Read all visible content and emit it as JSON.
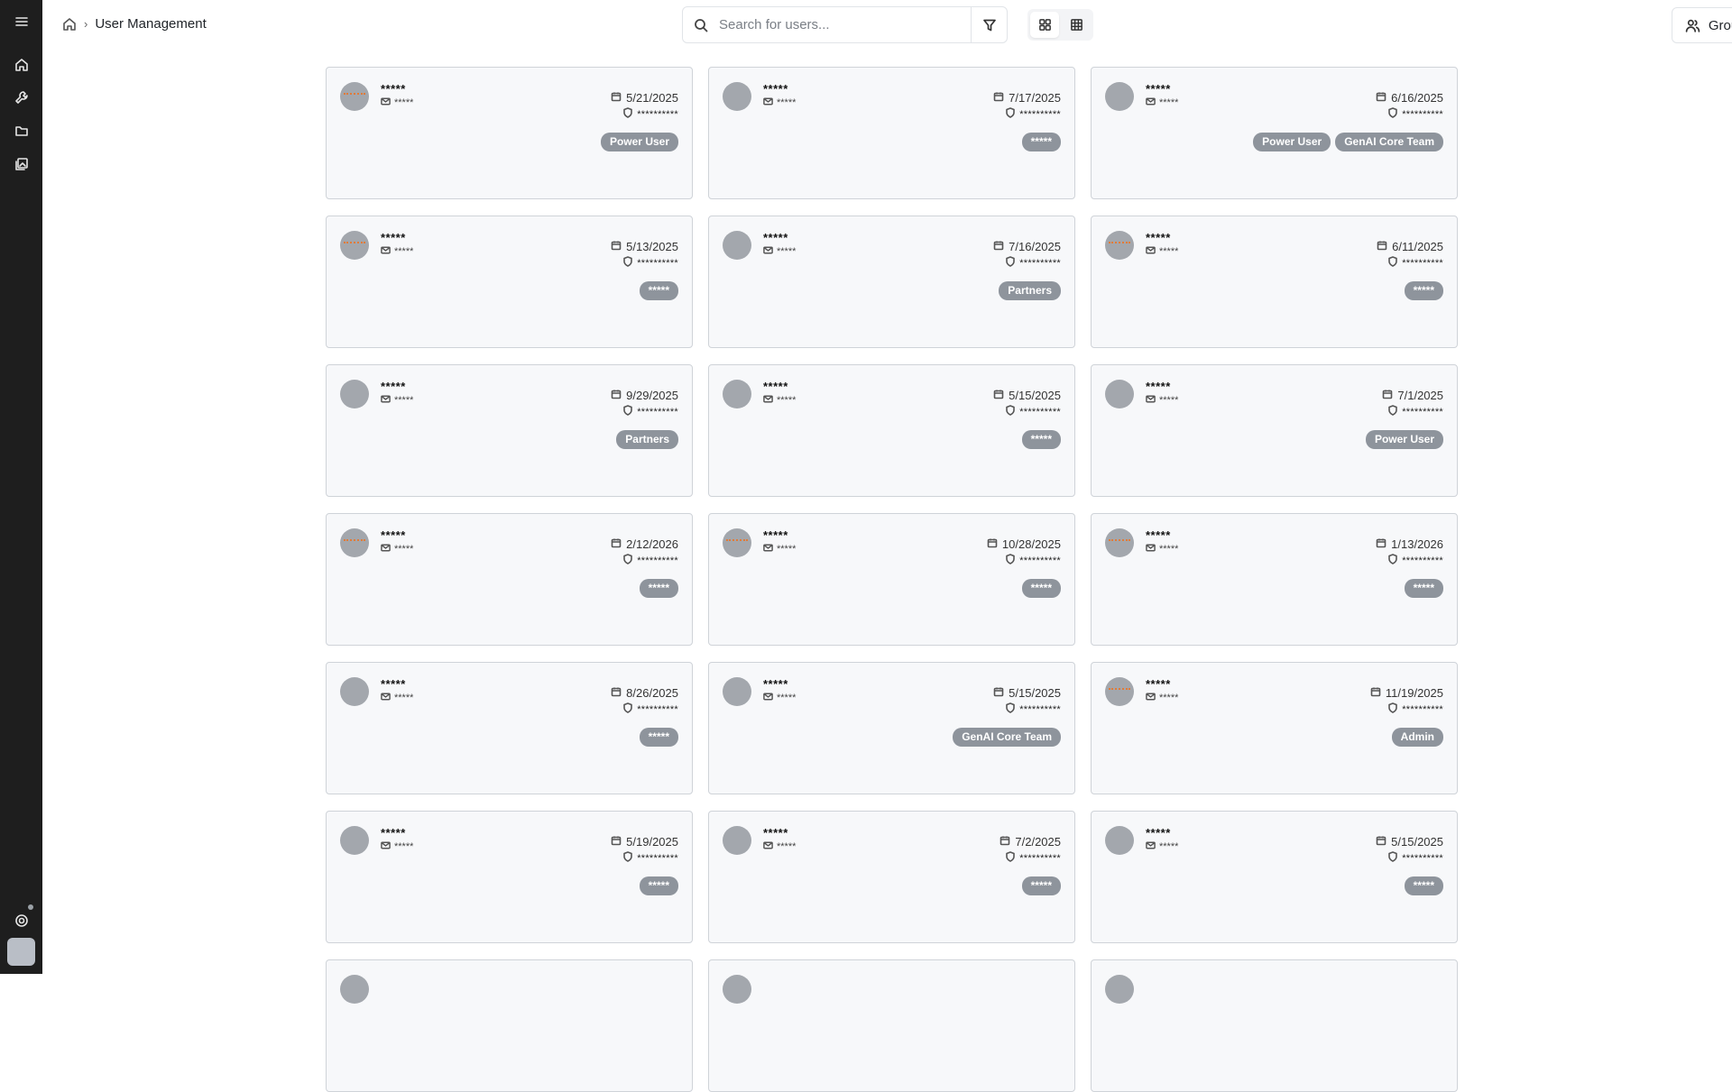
{
  "breadcrumb": {
    "title": "User Management"
  },
  "search": {
    "placeholder": "Search for users..."
  },
  "header": {
    "groups_label": "Groups"
  },
  "cards": [
    {
      "name": "*****",
      "email": "*****",
      "date": "5/21/2025",
      "role": "**********",
      "tags": [
        "Power User"
      ],
      "avatar_style": "orange"
    },
    {
      "name": "*****",
      "email": "*****",
      "date": "7/17/2025",
      "role": "**********",
      "tags": [
        "*****"
      ],
      "avatar_style": "plain"
    },
    {
      "name": "*****",
      "email": "*****",
      "date": "6/16/2025",
      "role": "**********",
      "tags": [
        "Power User",
        "GenAI Core Team"
      ],
      "avatar_style": "plain"
    },
    {
      "name": "*****",
      "email": "*****",
      "date": "5/13/2025",
      "role": "**********",
      "tags": [
        "*****"
      ],
      "avatar_style": "orange"
    },
    {
      "name": "*****",
      "email": "*****",
      "date": "7/16/2025",
      "role": "**********",
      "tags": [
        "Partners"
      ],
      "avatar_style": "plain"
    },
    {
      "name": "*****",
      "email": "*****",
      "date": "6/11/2025",
      "role": "**********",
      "tags": [
        "*****"
      ],
      "avatar_style": "orange"
    },
    {
      "name": "*****",
      "email": "*****",
      "date": "9/29/2025",
      "role": "**********",
      "tags": [
        "Partners"
      ],
      "avatar_style": "plain"
    },
    {
      "name": "*****",
      "email": "*****",
      "date": "5/15/2025",
      "role": "**********",
      "tags": [
        "*****"
      ],
      "avatar_style": "plain"
    },
    {
      "name": "*****",
      "email": "*****",
      "date": "7/1/2025",
      "role": "**********",
      "tags": [
        "Power User"
      ],
      "avatar_style": "plain"
    },
    {
      "name": "*****",
      "email": "*****",
      "date": "2/12/2026",
      "role": "**********",
      "tags": [
        "*****"
      ],
      "avatar_style": "orange"
    },
    {
      "name": "*****",
      "email": "*****",
      "date": "10/28/2025",
      "role": "**********",
      "tags": [
        "*****"
      ],
      "avatar_style": "orange"
    },
    {
      "name": "*****",
      "email": "*****",
      "date": "1/13/2026",
      "role": "**********",
      "tags": [
        "*****"
      ],
      "avatar_style": "orange"
    },
    {
      "name": "*****",
      "email": "*****",
      "date": "8/26/2025",
      "role": "**********",
      "tags": [
        "*****"
      ],
      "avatar_style": "plain"
    },
    {
      "name": "*****",
      "email": "*****",
      "date": "5/15/2025",
      "role": "**********",
      "tags": [
        "GenAI Core Team"
      ],
      "avatar_style": "plain"
    },
    {
      "name": "*****",
      "email": "*****",
      "date": "11/19/2025",
      "role": "**********",
      "tags": [
        "Admin"
      ],
      "avatar_style": "orange"
    },
    {
      "name": "*****",
      "email": "*****",
      "date": "5/19/2025",
      "role": "**********",
      "tags": [
        "*****"
      ],
      "avatar_style": "plain"
    },
    {
      "name": "*****",
      "email": "*****",
      "date": "7/2/2025",
      "role": "**********",
      "tags": [
        "*****"
      ],
      "avatar_style": "plain"
    },
    {
      "name": "*****",
      "email": "*****",
      "date": "5/15/2025",
      "role": "**********",
      "tags": [
        "*****"
      ],
      "avatar_style": "plain"
    },
    {
      "name": "",
      "email": "",
      "date": "",
      "role": "",
      "tags": [],
      "avatar_style": "plain"
    },
    {
      "name": "",
      "email": "",
      "date": "",
      "role": "",
      "tags": [],
      "avatar_style": "plain"
    },
    {
      "name": "",
      "email": "",
      "date": "",
      "role": "",
      "tags": [],
      "avatar_style": "plain"
    }
  ]
}
